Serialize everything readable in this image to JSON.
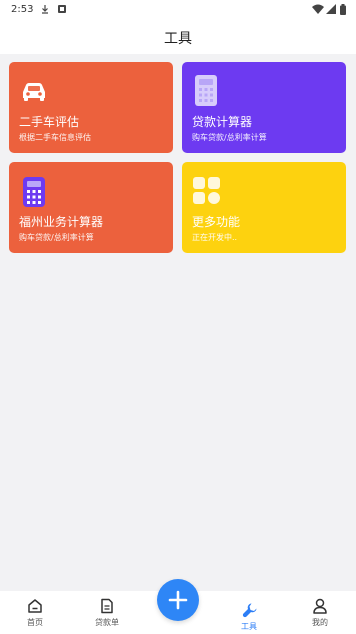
{
  "status_bar": {
    "time": "2:53"
  },
  "header": {
    "title": "工具"
  },
  "tools": [
    {
      "title": "二手车评估",
      "subtitle": "根据二手车信息评估",
      "color": "#ec613d",
      "icon": "car-icon"
    },
    {
      "title": "贷款计算器",
      "subtitle": "购车贷款/总利率计算",
      "color": "#6d3af1",
      "icon": "calculator-icon"
    },
    {
      "title": "福州业务计算器",
      "subtitle": "购车贷款/总利率计算",
      "color": "#ec613d",
      "icon": "calculator-icon"
    },
    {
      "title": "更多功能",
      "subtitle": "正在开发中..",
      "color": "#fdd20f",
      "icon": "grid-icon"
    }
  ],
  "bottom_nav": {
    "items": [
      {
        "label": "首页",
        "icon": "home-icon"
      },
      {
        "label": "贷款单",
        "icon": "document-icon"
      },
      {
        "label": "工具",
        "icon": "wrench-icon",
        "active": true
      },
      {
        "label": "我的",
        "icon": "user-icon"
      }
    ],
    "fab_icon": "plus-icon"
  },
  "colors": {
    "accent": "#2e86f6",
    "orange": "#ec613d",
    "purple": "#6d3af1",
    "yellow": "#fdd20f"
  }
}
